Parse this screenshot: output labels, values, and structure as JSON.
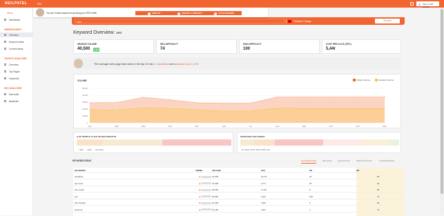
{
  "header": {
    "logo": "NEILPATEL",
    "lang": "EN",
    "google_btn": "Sign in with Google"
  },
  "promo": {
    "text": "You are 3 steps away from growing your SEO traffic",
    "steps": [
      {
        "n": "1",
        "label": "SIGN UP"
      },
      {
        "n": "2",
        "label": "CREATE A PROJECT"
      },
      {
        "n": "3",
        "label": "FIX KEYWORDS"
      }
    ]
  },
  "sidebar": {
    "menu": "Menu",
    "dashboard": "Dashboard",
    "s1": "UBERSUGGEST",
    "s1_items": [
      "Overview",
      "Keyword Ideas",
      "Content Ideas"
    ],
    "s2": "TRAFFIC ANALYZER",
    "s2_items": [
      "Overview",
      "Top Pages",
      "Keywords"
    ],
    "s3": "SEO ANALYZER",
    "s3_items": [
      "Site Audit",
      "Backlinks"
    ]
  },
  "search": {
    "query": "seo",
    "location": "Trinidad & Tobago",
    "button": "Search"
  },
  "overview": {
    "title": "Keyword Overview:",
    "keyword": "seo"
  },
  "cards": [
    {
      "label": "SEARCH VOLUME",
      "value": "40,500",
      "badge": "+45"
    },
    {
      "label": "SEO DIFFICULTY",
      "value": "74"
    },
    {
      "label": "PAID DIFFICULTY",
      "value": "100"
    },
    {
      "label": "COST PER CLICK (CPC)",
      "value": "5,44r"
    }
  ],
  "info": {
    "pre": "The average web page that ranks in the top 10 has",
    "bl": "11 backlinks",
    "mid": "and a",
    "ds": "domain score of 35."
  },
  "chart_data": {
    "type": "area",
    "title": "VOLUME",
    "categories": [
      "JAN",
      "FEB",
      "MAR",
      "APR",
      "MAY",
      "JUN",
      "JUL",
      "AUG",
      "SEP",
      "OCT",
      "NOV",
      "DEC"
    ],
    "yticks": [
      "50,000",
      "40,000",
      "30,000",
      "20,000",
      "10,000",
      "0"
    ],
    "ylim": [
      0,
      50000
    ],
    "series": [
      {
        "name": "Mobile Volume",
        "color": "#f9a07a",
        "values": [
          29000,
          29500,
          37000,
          33500,
          29000,
          28500,
          28500,
          37500,
          37500,
          37500,
          37500,
          37500
        ]
      },
      {
        "name": "Desktop Volume",
        "color": "#f8c63f",
        "values": [
          19000,
          18500,
          22000,
          21000,
          19000,
          17000,
          17000,
          21500,
          21000,
          21000,
          21000,
          21000
        ]
      }
    ]
  },
  "panels": {
    "left_title": "& OF PEOPLE CLICK ON SEO RESULTS",
    "left_legend": [
      "SEO",
      "Paid",
      "No clicks"
    ],
    "right_title": "SEARCHES AGE RANGE",
    "right_legend": [
      "18",
      "18-24",
      "25-34",
      "35-44",
      "45-54",
      "55+"
    ]
  },
  "kwtabs": {
    "title": "KEYWORD IDEAS",
    "tabs": [
      "SUGGESTIONS",
      "RELATED",
      "QUESTIONS",
      "PREPOSITIONS",
      "COMPARISONS"
    ]
  },
  "table": {
    "headers": [
      "KEYWORD",
      "TREND",
      "VOLUME",
      "CPC",
      "PD",
      "SD"
    ],
    "rows": [
      [
        "backlinks",
        "",
        "10,000",
        "15,74r",
        "24",
        "50"
      ],
      [
        "seo tools",
        "",
        "74,000",
        "2,77r",
        "15",
        "34"
      ],
      [
        "seo expert",
        "",
        "40,000",
        "17,51r",
        "6",
        "65"
      ],
      [
        "seo",
        "",
        "40,500",
        "5,44r",
        "100",
        "74"
      ],
      [
        "site checker",
        "",
        "22,300",
        "4,09r",
        "3",
        "36"
      ],
      [
        "semrush",
        "",
        "27,100",
        "4,26r",
        "1",
        "74"
      ]
    ]
  }
}
